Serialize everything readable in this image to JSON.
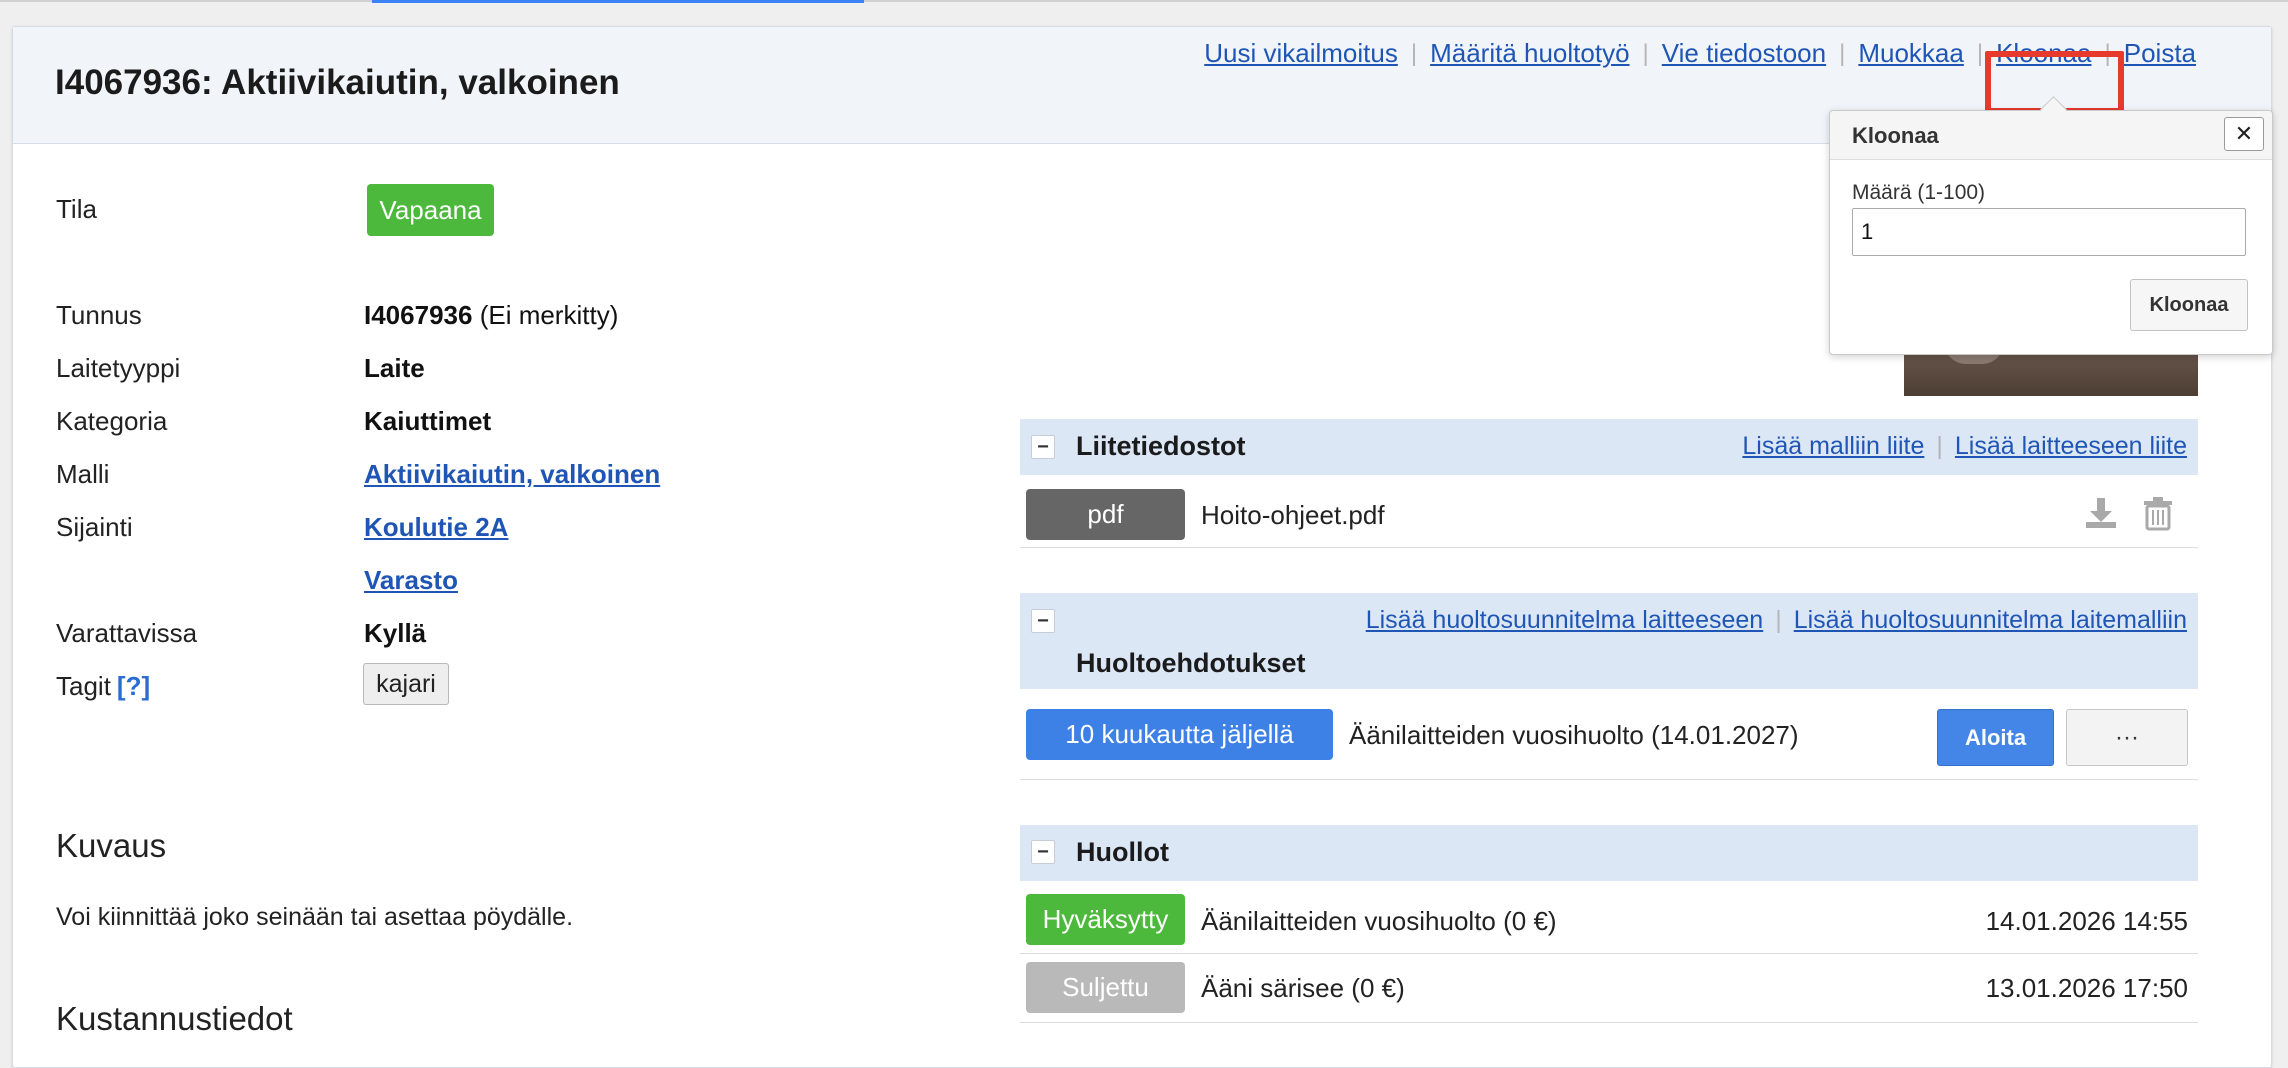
{
  "header": {
    "title": "I4067936: Aktiivikaiutin, valkoinen",
    "actions": {
      "new_fault": "Uusi vikailmoitus",
      "assign_service": "Määritä huoltotyö",
      "export": "Vie tiedostoon",
      "edit": "Muokkaa",
      "clone": "Kloonaa",
      "delete": "Poista"
    }
  },
  "details": {
    "status_label": "Tila",
    "status_value": "Vapaana",
    "id_label": "Tunnus",
    "id_value": "I4067936",
    "id_note": "(Ei merkitty)",
    "type_label": "Laitetyyppi",
    "type_value": "Laite",
    "category_label": "Kategoria",
    "category_value": "Kaiuttimet",
    "model_label": "Malli",
    "model_value": "Aktiivikaiutin, valkoinen",
    "location_label": "Sijainti",
    "location_value": "Koulutie 2A",
    "location_sub": "Varasto",
    "reservable_label": "Varattavissa",
    "reservable_value": "Kyllä",
    "tags_label": "Tagit",
    "tags_help": "[?]",
    "tags": [
      "kajari"
    ]
  },
  "description": {
    "heading": "Kuvaus",
    "text": "Voi kiinnittää joko seinään tai asettaa pöydälle."
  },
  "costs": {
    "heading": "Kustannustiedot"
  },
  "attachments": {
    "collapse": "−",
    "title": "Liitetiedostot",
    "add_model": "Lisää malliin liite",
    "add_device": "Lisää laitteeseen liite",
    "items": [
      {
        "type": "pdf",
        "name": "Hoito-ohjeet.pdf"
      }
    ]
  },
  "suggestions": {
    "collapse": "−",
    "title": "Huoltoehdotukset",
    "add_device": "Lisää huoltosuunnitelma laitteeseen",
    "add_model": "Lisää huoltosuunnitelma laitemalliin",
    "items": [
      {
        "badge": "10 kuukautta jäljellä",
        "text": "Äänilaitteiden vuosihuolto (14.01.2027)",
        "start": "Aloita",
        "more": "···"
      }
    ]
  },
  "services": {
    "collapse": "−",
    "title": "Huollot",
    "items": [
      {
        "status": "Hyväksytty",
        "text": "Äänilaitteiden vuosihuolto (0 €)",
        "date": "14.01.2026 14:55"
      },
      {
        "status": "Suljettu",
        "text": "Ääni särisee (0 €)",
        "date": "13.01.2026 17:50"
      }
    ]
  },
  "clone_popover": {
    "title": "Kloonaa",
    "close": "✕",
    "amount_label": "Määrä (1-100)",
    "amount_value": "1",
    "submit": "Kloonaa"
  },
  "colors": {
    "accent": "#1f56b5",
    "status_free": "#4cb93c",
    "highlight": "#e53a2c",
    "panel_header": "#dce7f6"
  }
}
